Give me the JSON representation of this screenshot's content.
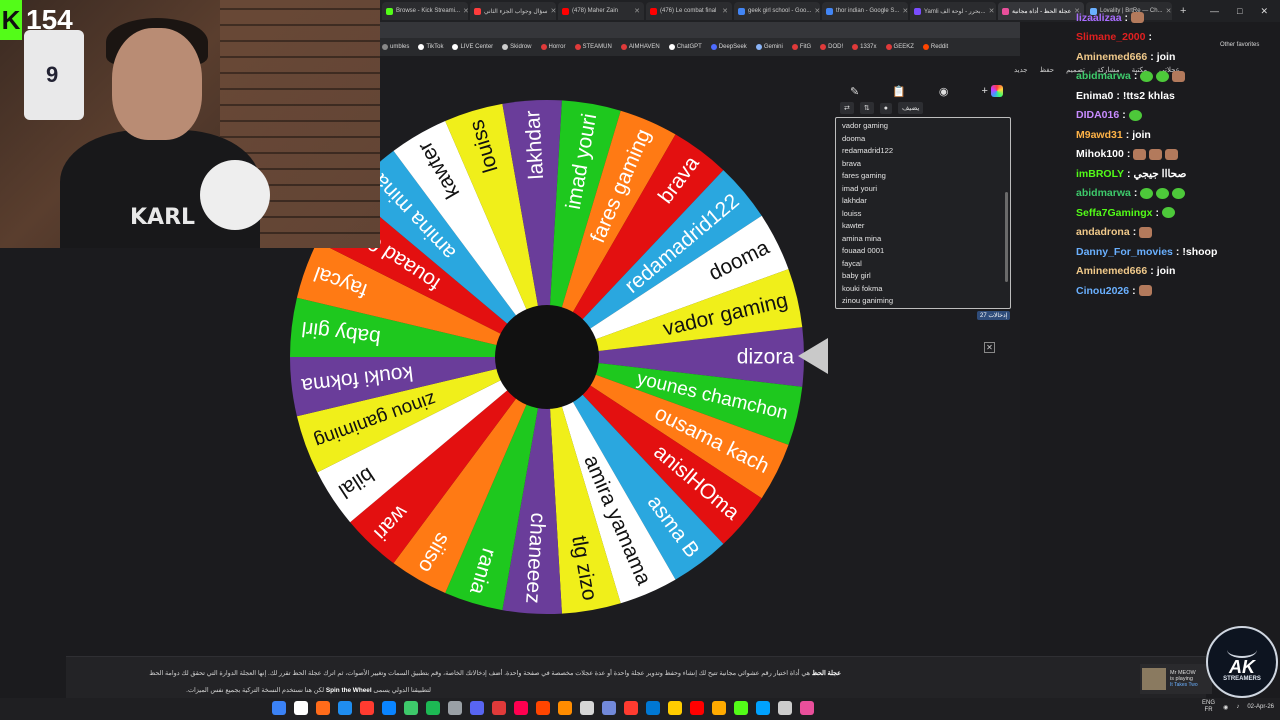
{
  "stream": {
    "viewer_count": "154",
    "shirt_text": "KARL",
    "jersey_number": "9"
  },
  "browser": {
    "tabs": [
      {
        "label": "Browse - Kick Streami...",
        "color": "#53fc18",
        "active": false
      },
      {
        "label": "سؤال وجواب الجزء الثاني",
        "color": "#ff3c3c",
        "active": false
      },
      {
        "label": "(478) Maher Zain",
        "color": "#ff0000",
        "active": false
      },
      {
        "label": "(476) Le combat final",
        "color": "#ff0000",
        "active": false
      },
      {
        "label": "geek girl school - Goo...",
        "color": "#4285f4",
        "active": false
      },
      {
        "label": "thor indian - Google S...",
        "color": "#4285f4",
        "active": false
      },
      {
        "label": "Yamli بحرر - لوحة الف...",
        "color": "#7a4dff",
        "active": false
      },
      {
        "label": "عجلة الحظ - أداة مجانية",
        "color": "#e94f9b",
        "active": true
      },
      {
        "label": "Lovality | BrtRe — Ch...",
        "color": "#6ab0ff",
        "active": false
      }
    ],
    "bookmarks": [
      {
        "label": "umbles",
        "color": "#888888"
      },
      {
        "label": "TikTok",
        "color": "#ffffff"
      },
      {
        "label": "LIVE Center",
        "color": "#ffffff"
      },
      {
        "label": "Skidrow",
        "color": "#cccccc"
      },
      {
        "label": "Horror",
        "color": "#e03a3a"
      },
      {
        "label": "STEAMUN",
        "color": "#e03a3a"
      },
      {
        "label": "AIMHAVEN",
        "color": "#e03a3a"
      },
      {
        "label": "ChatGPT",
        "color": "#ffffff"
      },
      {
        "label": "DeepSeek",
        "color": "#4d6bfe"
      },
      {
        "label": "Gemini",
        "color": "#8ab4f8"
      },
      {
        "label": "FitG",
        "color": "#e03a3a"
      },
      {
        "label": "DOD!",
        "color": "#e03a3a"
      },
      {
        "label": "1337x",
        "color": "#e03a3a"
      },
      {
        "label": "GEEKZ",
        "color": "#e03a3a"
      },
      {
        "label": "Reddit",
        "color": "#ff4500"
      }
    ],
    "other_favorites": "Other favorites"
  },
  "wheel": {
    "segments": [
      {
        "name": "dizora",
        "color": "#6a3d9a"
      },
      {
        "name": "younes chamchon",
        "color": "#1ec81e"
      },
      {
        "name": "ousama kach",
        "color": "#ff7a14"
      },
      {
        "name": "anislHOma",
        "color": "#e31010"
      },
      {
        "name": "asma B",
        "color": "#2aa7df"
      },
      {
        "name": "amira yamama",
        "color": "#ffffff"
      },
      {
        "name": "tlg zizo",
        "color": "#f0ef1a"
      },
      {
        "name": "chaneeez",
        "color": "#6a3d9a"
      },
      {
        "name": "rania",
        "color": "#1ec81e"
      },
      {
        "name": "siiso",
        "color": "#ff7a14"
      },
      {
        "name": "wari",
        "color": "#e31010"
      },
      {
        "name": "bilal",
        "color": "#ffffff"
      },
      {
        "name": "zinou ganiming",
        "color": "#f0ef1a"
      },
      {
        "name": "kouki fokma",
        "color": "#6a3d9a"
      },
      {
        "name": "baby girl",
        "color": "#1ec81e"
      },
      {
        "name": "faycal",
        "color": "#ff7a14"
      },
      {
        "name": "fouaad 0001",
        "color": "#e31010"
      },
      {
        "name": "amina mina",
        "color": "#2aa7df"
      },
      {
        "name": "kawter",
        "color": "#ffffff"
      },
      {
        "name": "louiss",
        "color": "#f0ef1a"
      },
      {
        "name": "lakhdar",
        "color": "#6a3d9a"
      },
      {
        "name": "imad youri",
        "color": "#1ec81e"
      },
      {
        "name": "fares gaming",
        "color": "#ff7a14"
      },
      {
        "name": "brava",
        "color": "#e31010"
      },
      {
        "name": "redamadrid122",
        "color": "#2aa7df"
      },
      {
        "name": "dooma",
        "color": "#ffffff"
      },
      {
        "name": "vador gaming",
        "color": "#f0ef1a"
      }
    ]
  },
  "panel": {
    "shuffle_label": "يضيف",
    "entries": [
      "vador gaming",
      "dooma",
      "redamadrid122",
      "brava",
      "fares gaming",
      "imad youri",
      "lakhdar",
      "louiss",
      "kawter",
      "amina mina",
      "fouaad 0001",
      "faycal",
      "baby girl",
      "kouki fokma",
      "zinou ganiming",
      "bilal"
    ],
    "count_badge": "27 إدخالات"
  },
  "rightbar": {
    "top_items": [
      "جديد",
      "حفظ",
      "تصميم",
      "مشاركة",
      "مكتبة",
      "عجلاتي"
    ]
  },
  "chat": [
    {
      "user": "lizaalizaa",
      "color": "#a86cff",
      "text": "",
      "emotes": [
        "face"
      ]
    },
    {
      "user": "Slimane_2000",
      "color": "#e02020",
      "text": "",
      "emotes": []
    },
    {
      "user": "Aminemed666",
      "color": "#f0c98a",
      "text": "join",
      "emotes": []
    },
    {
      "user": "abidmarwa",
      "color": "#3ec96b",
      "text": "",
      "emotes": [
        "green",
        "green",
        "face"
      ]
    },
    {
      "user": "Enima0",
      "color": "#ffffff",
      "text": "!tts2 khlas",
      "emotes": []
    },
    {
      "user": "DIDA016",
      "color": "#c78bff",
      "text": "",
      "emotes": [
        "green"
      ]
    },
    {
      "user": "M9awd31",
      "color": "#ffb347",
      "text": "join",
      "emotes": []
    },
    {
      "user": "Mihok100",
      "color": "#ffffff",
      "text": "",
      "emotes": [
        "face",
        "face",
        "face"
      ]
    },
    {
      "user": "imBROLY",
      "color": "#53fc18",
      "text": "صحااا جيجي",
      "emotes": []
    },
    {
      "user": "abidmarwa",
      "color": "#3ec96b",
      "text": "",
      "emotes": [
        "green",
        "green",
        "green"
      ]
    },
    {
      "user": "Seffa7Gamingx",
      "color": "#53fc18",
      "text": "",
      "emotes": [
        "green"
      ]
    },
    {
      "user": "andadrona",
      "color": "#f0c98a",
      "text": "",
      "emotes": [
        "face"
      ]
    },
    {
      "user": "Danny_For_movies",
      "color": "#6ab0ff",
      "text": "!shoop",
      "emotes": []
    },
    {
      "user": "Aminemed666",
      "color": "#f0c98a",
      "text": "join",
      "emotes": []
    },
    {
      "user": "Cinou2026",
      "color": "#6ab0ff",
      "text": "",
      "emotes": [
        "face"
      ]
    }
  ],
  "footer": {
    "line1_bold": "عجلة الحظ",
    "line1": "هي أداة اختيار رقم عشوائي مجانية تتيح لك إنشاء وحفظ وتدوير عجلة واحدة أو عدة عجلات مخصصة في صفحة واحدة. أضف إدخالاتك الخاصة، وقم بتطبيق السمات وتغيير الأصوات، ثم اترك عجلة الحظ تقرر لك. إنها العجلة الدوارة التي تحقق لك دوامة الحظ",
    "line2_pre": "لكن هنا نستخدم النسخة التركية بجميع نفس الميزات.",
    "line2_bold": "Spin the Wheel",
    "line2_post": "لتطبيقنا الدولي يسمى"
  },
  "notification": {
    "title": "Mr MEOW",
    "subtitle": "is playing",
    "game": "It Takes Two"
  },
  "logo": {
    "name": "AK",
    "sub": "STREAMERS"
  },
  "taskbar": {
    "lang1": "ENG",
    "lang2": "FR",
    "time": "",
    "date": "02-Apr-26"
  }
}
